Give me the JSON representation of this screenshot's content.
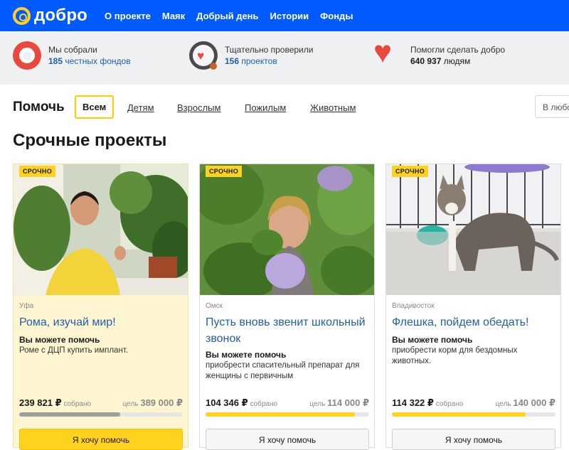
{
  "header": {
    "logo_text": "добро",
    "nav": [
      "О проекте",
      "Маяк",
      "Добрый день",
      "Истории",
      "Фонды"
    ]
  },
  "stats": [
    {
      "icon": "lifebuoy-icon",
      "line1": "Мы собрали",
      "num": "185",
      "rest": "честных фондов"
    },
    {
      "icon": "magnifier-heart-icon",
      "line1": "Тщательно проверили",
      "num": "156",
      "rest": "проектов"
    },
    {
      "icon": "heart-icon",
      "line1": "Помогли сделать добро",
      "num": "640 937",
      "rest": "людям"
    }
  ],
  "filter": {
    "title": "Помочь",
    "buttons": [
      "Всем",
      "Детям",
      "Взрослым",
      "Пожилым",
      "Животным"
    ],
    "search_partial": "В любо"
  },
  "section_title": "Срочные проекты",
  "colors": {
    "brand": "#005bff",
    "accent": "#ffd21f",
    "link": "#1f5fa8",
    "progress_grey": "#9e9e9e"
  },
  "cards": [
    {
      "badge": "СРОЧНО",
      "city": "Уфа",
      "title": "Рома, изучай мир!",
      "help_label": "Вы можете помочь",
      "help_text": "Роме с ДЦП купить имплант.",
      "collected": "239 821 ₽",
      "collected_suffix": "собрано",
      "goal_prefix": "цель",
      "goal": "389 000 ₽",
      "progress": 0.617,
      "bar_color": "#9e9e9e",
      "cta": "Я хочу помочь"
    },
    {
      "badge": "СРОЧНО",
      "city": "Омск",
      "title": "Пусть вновь звенит школьный звонок",
      "help_label": "Вы можете помочь",
      "help_text": "приобрести спасительный препарат для женщины с первичным",
      "collected": "104 346 ₽",
      "collected_suffix": "собрано",
      "goal_prefix": "цель",
      "goal": "114 000 ₽",
      "progress": 0.915,
      "bar_color": "#ffd21f",
      "cta": "Я хочу помочь"
    },
    {
      "badge": "СРОЧНО",
      "city": "Владивосток",
      "title": "Флешка, пойдем обедать!",
      "help_label": "Вы можете помочь",
      "help_text": "приобрести корм для бездомных животных.",
      "collected": "114 322 ₽",
      "collected_suffix": "собрано",
      "goal_prefix": "цель",
      "goal": "140 000 ₽",
      "progress": 0.817,
      "bar_color": "#ffd21f",
      "cta": "Я хочу помочь"
    }
  ]
}
